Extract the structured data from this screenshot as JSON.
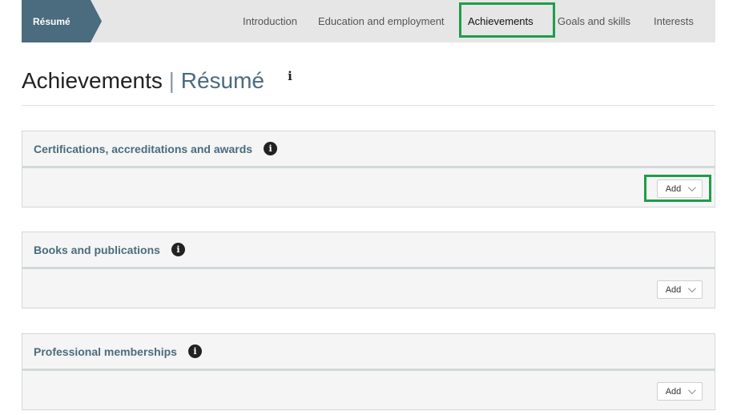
{
  "nav": {
    "brand": "Résumé",
    "tabs": [
      {
        "label": "Introduction",
        "active": false
      },
      {
        "label": "Education and employment",
        "active": false
      },
      {
        "label": "Achievements",
        "active": true
      },
      {
        "label": "Goals and skills",
        "active": false
      },
      {
        "label": "Interests",
        "active": false
      }
    ]
  },
  "heading": {
    "title": "Achievements",
    "separator": "|",
    "subtitle": "Résumé",
    "info_icon": "info-icon"
  },
  "sections": [
    {
      "title": "Certifications, accreditations and awards",
      "add_label": "Add",
      "highlighted": true
    },
    {
      "title": "Books and publications",
      "add_label": "Add",
      "highlighted": false
    },
    {
      "title": "Professional memberships",
      "add_label": "Add",
      "highlighted": false
    }
  ],
  "colors": {
    "brand": "#4b6b7e",
    "highlight": "#1f9d49",
    "nav_background": "#e6e6e6",
    "panel_background": "#f5f5f5"
  }
}
